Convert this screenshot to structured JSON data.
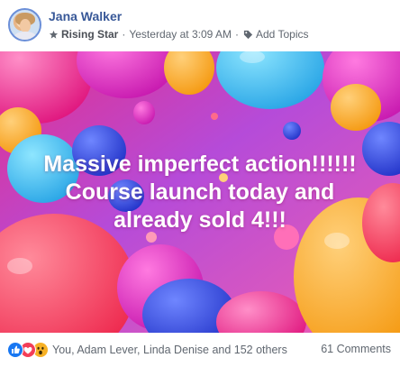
{
  "post": {
    "author": "Jana Walker",
    "badge": "Rising Star",
    "separator": "·",
    "timestamp": "Yesterday at 3:09 AM",
    "separator2": "·",
    "topics_link": "Add Topics"
  },
  "banner": {
    "lines": [
      "Massive imperfect action!!!!!!",
      "Course launch today and",
      "already sold 4!!!"
    ],
    "theme": "balloons",
    "text_color": "#ffffff"
  },
  "footer": {
    "reactions": [
      "like-icon",
      "love-icon",
      "wow-icon"
    ],
    "reaction_summary": "You, Adam Lever, Linda Denise and 152 others",
    "comments": "61 Comments"
  },
  "colors": {
    "author_link": "#385898",
    "meta_text": "#606770",
    "like": "#1877f2",
    "love": "#f33e58",
    "wow": "#f7b125"
  }
}
